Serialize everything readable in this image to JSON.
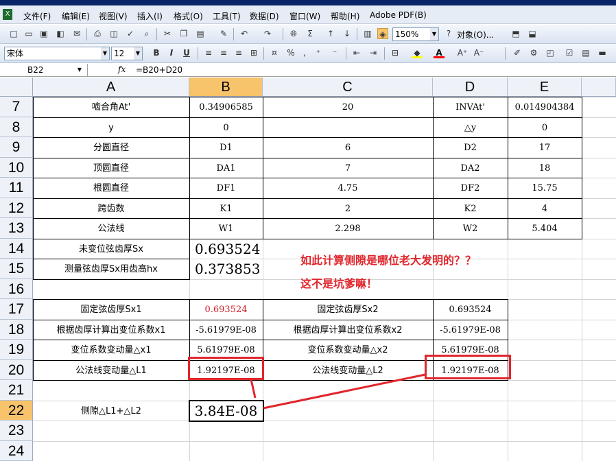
{
  "menus": [
    "文件(F)",
    "编辑(E)",
    "视图(V)",
    "插入(I)",
    "格式(O)",
    "工具(T)",
    "数据(D)",
    "窗口(W)",
    "帮助(H)",
    "Adobe PDF(B)"
  ],
  "toolbar": {
    "zoom": "150%",
    "objects_label": "对象(O)...",
    "font_name": "宋体",
    "font_size": "12",
    "bold": "B",
    "italic": "I",
    "underline": "U",
    "percent": "%",
    "comma": ",",
    "sigma": "Σ",
    "font_color": "A"
  },
  "formula_bar": {
    "name_box": "B22",
    "fx": "fx",
    "formula": "=B20+D20"
  },
  "columns": [
    "A",
    "B",
    "C",
    "D",
    "E"
  ],
  "selected_column": "B",
  "rows": [
    "7",
    "8",
    "9",
    "10",
    "11",
    "12",
    "13",
    "14",
    "15",
    "16",
    "17",
    "18",
    "19",
    "20",
    "21",
    "22",
    "23",
    "24"
  ],
  "selected_row": "22",
  "cells": {
    "A7": "啮合角At'",
    "B7": "0.34906585",
    "C7": "20",
    "D7": "INVAt'",
    "E7": "0.014904384",
    "A8": "y",
    "B8": "0",
    "D8": "△y",
    "E8": "0",
    "A9": "分圆直径",
    "B9": "D1",
    "C9": "6",
    "D9": "D2",
    "E9": "17",
    "A10": "顶圆直径",
    "B10": "DA1",
    "C10": "7",
    "D10": "DA2",
    "E10": "18",
    "A11": "根圆直径",
    "B11": "DF1",
    "C11": "4.75",
    "D11": "DF2",
    "E11": "15.75",
    "A12": "跨齿数",
    "B12": "K1",
    "C12": "2",
    "D12": "K2",
    "E12": "4",
    "A13": "公法线",
    "B13": "W1",
    "C13": "2.298",
    "D13": "W2",
    "E13": "5.404",
    "A14": "未变位弦齿厚Sx",
    "B14": "0.693524",
    "A15": "测量弦齿厚Sx用齿高hx",
    "B15": "0.373853",
    "A17": "固定弦齿厚Sx1",
    "B17": "0.693524",
    "C17": "固定弦齿厚Sx2",
    "D17": "0.693524",
    "A18": "根据齿厚计算出变位系数x1",
    "B18": "-5.61979E-08",
    "C18": "根据齿厚计算出变位系数x2",
    "D18": "-5.61979E-08",
    "A19": "变位系数变动量△x1",
    "B19": "5.61979E-08",
    "C19": "变位系数变动量△x2",
    "D19": "5.61979E-08",
    "A20": "公法线变动量△L1",
    "B20": "1.92197E-08",
    "C20": "公法线变动量△L2",
    "D20": "1.92197E-08",
    "A22": "侧隙△L1+△L2",
    "B22": "3.84E-08"
  },
  "annotation": {
    "line1": "如此计算侧隙是哪位老大发明的？？",
    "line2": "这不是坑爹嘛！",
    "color": "#e0262c"
  }
}
